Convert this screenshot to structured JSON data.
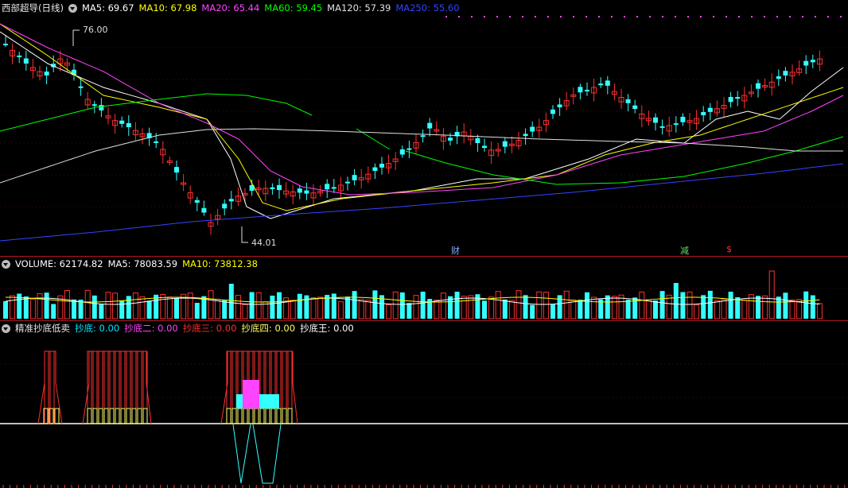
{
  "top_pane": {
    "title": "西部超导(日线)",
    "indicators": [
      {
        "label": "MA5: 69.67",
        "color": "#ffffff"
      },
      {
        "label": "MA10: 67.98",
        "color": "#ffff00"
      },
      {
        "label": "MA20: 65.44",
        "color": "#ff44ff"
      },
      {
        "label": "MA60: 59.45",
        "color": "#00ff00"
      },
      {
        "label": "MA120: 57.39",
        "color": "#e0e0e0"
      },
      {
        "label": "MA250: 55.60",
        "color": "#3344ff"
      }
    ],
    "high_label": "76.00",
    "low_label": "44.01",
    "markers": [
      {
        "text": "财",
        "color": "#7fb0ff"
      },
      {
        "text": "减",
        "color": "#66dd66"
      },
      {
        "text": "$",
        "color": "#ff3030"
      }
    ]
  },
  "volume_pane": {
    "indicators": [
      {
        "label": "VOLUME: 62174.82",
        "color": "#ffffff"
      },
      {
        "label": "MA5: 78083.59",
        "color": "#ffffff"
      },
      {
        "label": "MA10: 73812.38",
        "color": "#ffff00"
      }
    ]
  },
  "signal_pane": {
    "title": "精准抄底低卖",
    "indicators": [
      {
        "label": "抄底: 0.00",
        "color": "#00e5ff"
      },
      {
        "label": "抄底二: 0.00",
        "color": "#ff44ff"
      },
      {
        "label": "抄底三: 0.00",
        "color": "#ff3030"
      },
      {
        "label": "抄底四: 0.00",
        "color": "#ffff66"
      },
      {
        "label": "抄底王: 0.00",
        "color": "#ffffff"
      }
    ]
  },
  "colors": {
    "up": "#ff3030",
    "down": "#33ffff",
    "frame": "#b01818"
  }
}
